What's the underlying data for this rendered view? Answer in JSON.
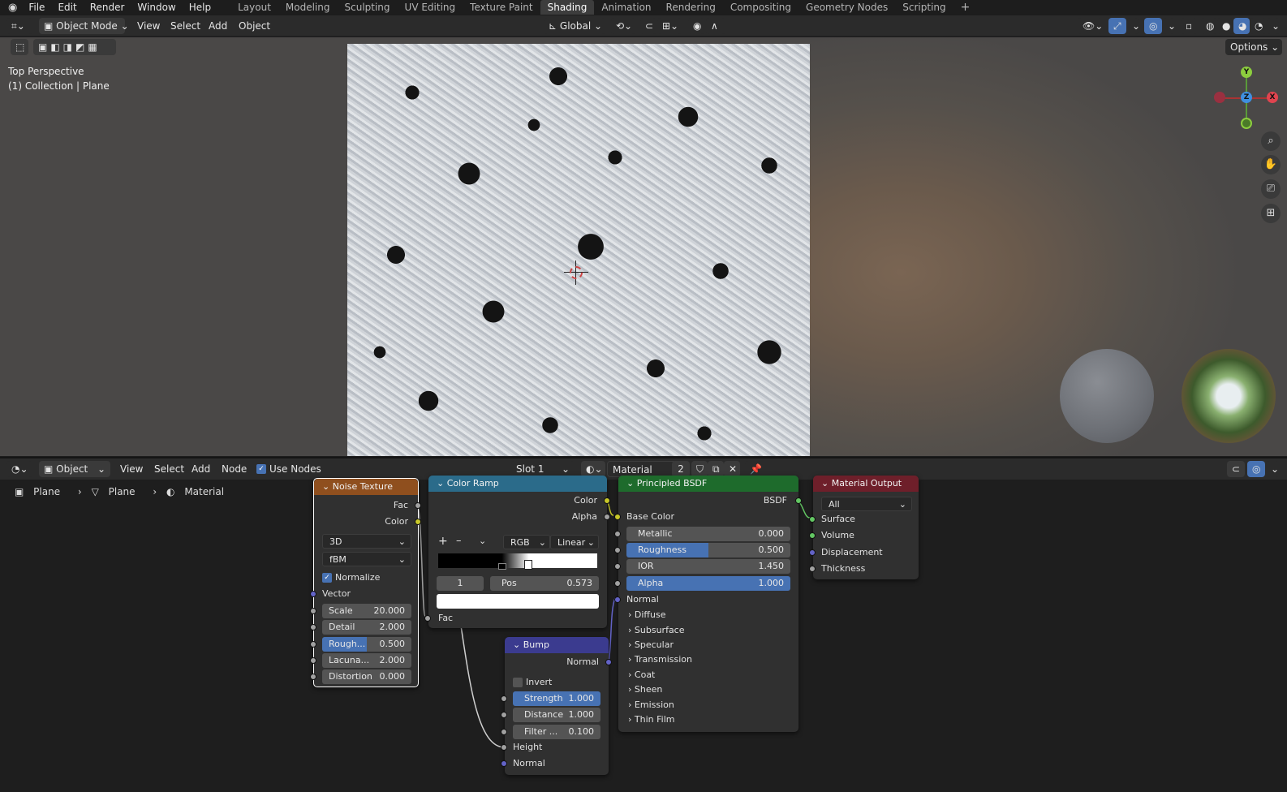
{
  "menu": {
    "items": [
      "File",
      "Edit",
      "Render",
      "Window",
      "Help"
    ],
    "workspaces": [
      "Layout",
      "Modeling",
      "Sculpting",
      "UV Editing",
      "Texture Paint",
      "Shading",
      "Animation",
      "Rendering",
      "Compositing",
      "Geometry Nodes",
      "Scripting"
    ],
    "active_workspace": "Shading",
    "add_tab": "+"
  },
  "viewport_header": {
    "mode": "Object Mode",
    "menus": [
      "View",
      "Select",
      "Add",
      "Object"
    ],
    "orientation": "Global",
    "options": "Options"
  },
  "viewport": {
    "view_name": "Top Perspective",
    "collection": "(1) Collection | Plane",
    "gizmo": {
      "y": "Y",
      "z": "Z",
      "x": "X"
    }
  },
  "node_header": {
    "editor": "Object",
    "menus": [
      "View",
      "Select",
      "Add",
      "Node"
    ],
    "use_nodes": "Use Nodes",
    "slot": "Slot 1",
    "material": "Material",
    "users": "2"
  },
  "breadcrumb": [
    "Plane",
    "Plane",
    "Material"
  ],
  "noise": {
    "title": "Noise Texture",
    "out_fac": "Fac",
    "out_color": "Color",
    "dim": "3D",
    "type": "fBM",
    "normalize": "Normalize",
    "vector": "Vector",
    "fields": [
      {
        "l": "Scale",
        "v": "20.000"
      },
      {
        "l": "Detail",
        "v": "2.000"
      },
      {
        "l": "Rough...",
        "v": "0.500"
      },
      {
        "l": "Lacuna...",
        "v": "2.000"
      },
      {
        "l": "Distortion",
        "v": "0.000"
      }
    ]
  },
  "ramp": {
    "title": "Color Ramp",
    "out_color": "Color",
    "out_alpha": "Alpha",
    "plus": "+",
    "minus": "–",
    "mode": "RGB",
    "interp": "Linear",
    "index": "1",
    "pos_label": "Pos",
    "pos": "0.573",
    "fac": "Fac"
  },
  "bump": {
    "title": "Bump",
    "out_normal": "Normal",
    "invert": "Invert",
    "fields": [
      {
        "l": "Strength",
        "v": "1.000"
      },
      {
        "l": "Distance",
        "v": "1.000"
      },
      {
        "l": "Filter ...",
        "v": "0.100"
      }
    ],
    "height": "Height",
    "normal": "Normal"
  },
  "bsdf": {
    "title": "Principled BSDF",
    "out": "BSDF",
    "base_color": "Base Color",
    "fields": [
      {
        "l": "Metallic",
        "v": "0.000"
      },
      {
        "l": "Roughness",
        "v": "0.500"
      },
      {
        "l": "IOR",
        "v": "1.450"
      },
      {
        "l": "Alpha",
        "v": "1.000"
      }
    ],
    "normal": "Normal",
    "panels": [
      "Diffuse",
      "Subsurface",
      "Specular",
      "Transmission",
      "Coat",
      "Sheen",
      "Emission",
      "Thin Film"
    ]
  },
  "output": {
    "title": "Material Output",
    "target": "All",
    "inputs": [
      "Surface",
      "Volume",
      "Displacement",
      "Thickness"
    ]
  },
  "colors": {
    "noise_hdr": "#8f4f1e",
    "ramp_hdr": "#2b6b8a",
    "bsdf_hdr": "#1e6b2c",
    "output_hdr": "#6e1f2a",
    "bump_hdr": "#3b3b8f",
    "accent": "#4772b3"
  }
}
